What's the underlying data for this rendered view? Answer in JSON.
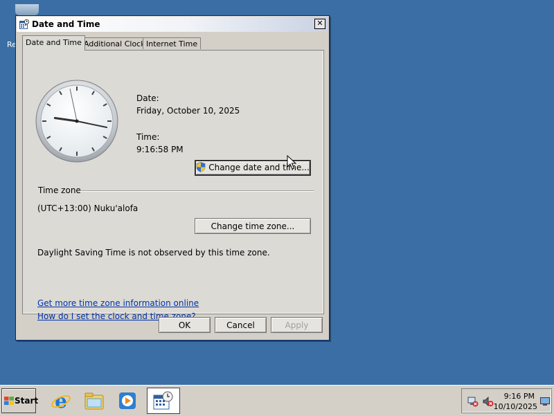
{
  "desktop": {
    "icon_label": "Re"
  },
  "window": {
    "title": "Date and Time",
    "close_glyph": "✕"
  },
  "tabs": [
    {
      "label": "Date and Time",
      "active": true
    },
    {
      "label": "Additional Clocks",
      "active": false
    },
    {
      "label": "Internet Time",
      "active": false
    }
  ],
  "date_time": {
    "date_label": "Date:",
    "date_value": "Friday, October 10, 2025",
    "time_label": "Time:",
    "time_value": "9:16:58 PM",
    "change_button": "Change date and time..."
  },
  "time_zone": {
    "group_label": "Time zone",
    "value": "(UTC+13:00) Nuku'alofa",
    "change_button": "Change time zone...",
    "dst_note": "Daylight Saving Time is not observed by this time zone."
  },
  "links": {
    "more_info": "Get more time zone information online",
    "how_to": "How do I set the clock and time zone?"
  },
  "dialog_buttons": {
    "ok": "OK",
    "cancel": "Cancel",
    "apply": "Apply"
  },
  "clock": {
    "hours": 9,
    "minutes": 16,
    "seconds": 58
  },
  "taskbar": {
    "start_label": "Start",
    "tray_time": "9:16 PM",
    "tray_date": "10/10/2025"
  },
  "icons": {
    "title": "calendar-clock-icon",
    "shield": "uac-shield-icon",
    "ie": "internet-explorer-icon",
    "explorer": "folder-explorer-icon",
    "media": "media-player-icon",
    "network": "network-disconnected-icon",
    "volume": "volume-muted-icon",
    "desktop_show": "show-desktop-icon"
  },
  "colors": {
    "desktop": "#3a6ea5",
    "link": "#0033aa",
    "dialog_bg": "#d4d0c8"
  }
}
